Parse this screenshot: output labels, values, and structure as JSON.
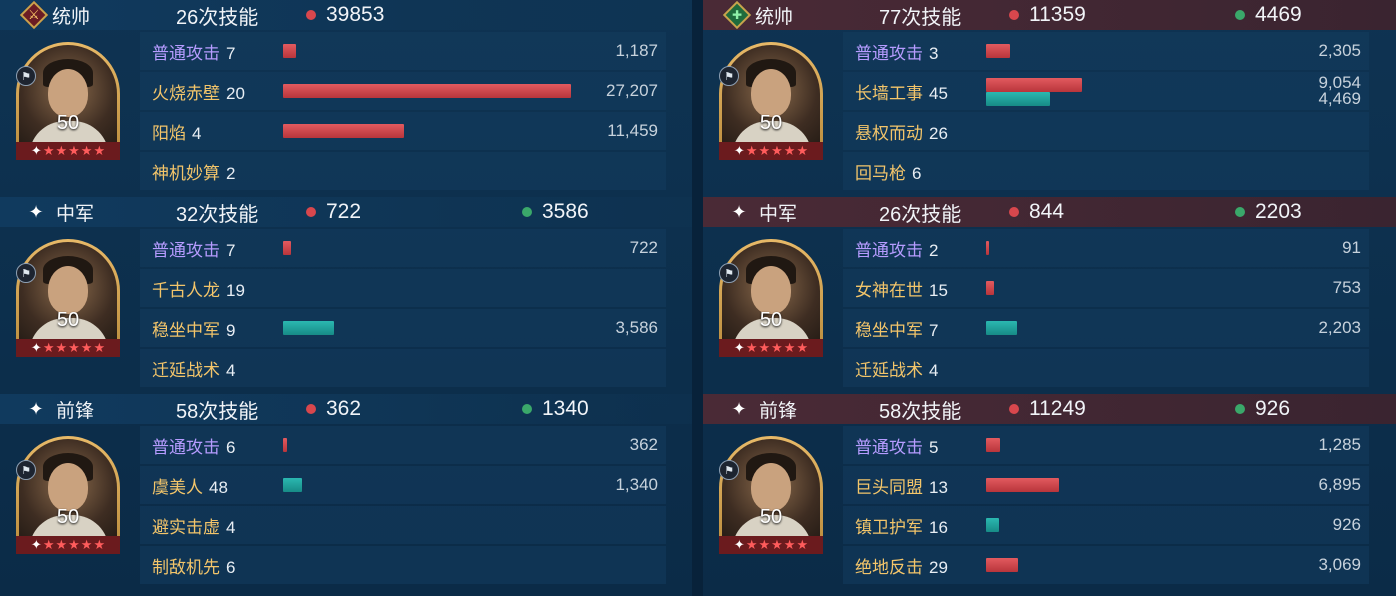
{
  "left": {
    "sections": [
      {
        "role": "统帅",
        "role_icon": "sword-icon",
        "skills": "26次技能",
        "damage": "39853",
        "heal": "",
        "level": "50",
        "stars": 5,
        "rows": [
          {
            "name": "普通攻击",
            "count": "7",
            "normal": true,
            "dmg": 1187,
            "heal": 0,
            "dmg_label": "1,187",
            "heal_label": ""
          },
          {
            "name": "火烧赤壁",
            "count": "20",
            "normal": false,
            "dmg": 27207,
            "heal": 0,
            "dmg_label": "27,207",
            "heal_label": ""
          },
          {
            "name": "阳焰",
            "count": "4",
            "normal": false,
            "dmg": 11459,
            "heal": 0,
            "dmg_label": "11,459",
            "heal_label": ""
          },
          {
            "name": "神机妙算",
            "count": "2",
            "normal": false,
            "dmg": 0,
            "heal": 0,
            "dmg_label": "",
            "heal_label": ""
          }
        ]
      },
      {
        "role": "中军",
        "role_icon": "sparkle-icon",
        "skills": "32次技能",
        "damage": "722",
        "heal": "3586",
        "level": "50",
        "stars": 5,
        "rows": [
          {
            "name": "普通攻击",
            "count": "7",
            "normal": true,
            "dmg": 722,
            "heal": 0,
            "dmg_label": "722",
            "heal_label": ""
          },
          {
            "name": "千古人龙",
            "count": "19",
            "normal": false,
            "dmg": 0,
            "heal": 0,
            "dmg_label": "",
            "heal_label": ""
          },
          {
            "name": "稳坐中军",
            "count": "9",
            "normal": false,
            "dmg": 0,
            "heal": 3586,
            "dmg_label": "",
            "heal_label": "3,586"
          },
          {
            "name": "迁延战术",
            "count": "4",
            "normal": false,
            "dmg": 0,
            "heal": 0,
            "dmg_label": "",
            "heal_label": ""
          }
        ]
      },
      {
        "role": "前锋",
        "role_icon": "sparkle-icon",
        "skills": "58次技能",
        "damage": "362",
        "heal": "1340",
        "level": "50",
        "stars": 5,
        "rows": [
          {
            "name": "普通攻击",
            "count": "6",
            "normal": true,
            "dmg": 362,
            "heal": 0,
            "dmg_label": "362",
            "heal_label": ""
          },
          {
            "name": "虞美人",
            "count": "48",
            "normal": false,
            "dmg": 0,
            "heal": 1340,
            "dmg_label": "",
            "heal_label": "1,340"
          },
          {
            "name": "避实击虚",
            "count": "4",
            "normal": false,
            "dmg": 0,
            "heal": 0,
            "dmg_label": "",
            "heal_label": ""
          },
          {
            "name": "制敌机先",
            "count": "6",
            "normal": false,
            "dmg": 0,
            "heal": 0,
            "dmg_label": "",
            "heal_label": ""
          }
        ]
      }
    ],
    "max_value": 27207
  },
  "right": {
    "sections": [
      {
        "role": "统帅",
        "role_icon": "heart-icon",
        "skills": "77次技能",
        "damage": "11359",
        "heal": "4469",
        "level": "50",
        "stars": 5,
        "rows": [
          {
            "name": "普通攻击",
            "count": "3",
            "normal": true,
            "dmg": 2305,
            "heal": 0,
            "dmg_label": "2,305",
            "heal_label": ""
          },
          {
            "name": "长墙工事",
            "count": "45",
            "normal": false,
            "dmg": 9054,
            "heal": 4469,
            "dmg_label": "9,054",
            "heal_label": "4,469"
          },
          {
            "name": "悬权而动",
            "count": "26",
            "normal": false,
            "dmg": 0,
            "heal": 0,
            "dmg_label": "",
            "heal_label": ""
          },
          {
            "name": "回马枪",
            "count": "6",
            "normal": false,
            "dmg": 0,
            "heal": 0,
            "dmg_label": "",
            "heal_label": ""
          }
        ]
      },
      {
        "role": "中军",
        "role_icon": "sparkle-icon",
        "skills": "26次技能",
        "damage": "844",
        "heal": "2203",
        "level": "50",
        "stars": 5,
        "rows": [
          {
            "name": "普通攻击",
            "count": "2",
            "normal": true,
            "dmg": 91,
            "heal": 0,
            "dmg_label": "91",
            "heal_label": ""
          },
          {
            "name": "女神在世",
            "count": "15",
            "normal": false,
            "dmg": 753,
            "heal": 0,
            "dmg_label": "753",
            "heal_label": ""
          },
          {
            "name": "稳坐中军",
            "count": "7",
            "normal": false,
            "dmg": 0,
            "heal": 2203,
            "dmg_label": "",
            "heal_label": "2,203"
          },
          {
            "name": "迁延战术",
            "count": "4",
            "normal": false,
            "dmg": 0,
            "heal": 0,
            "dmg_label": "",
            "heal_label": ""
          }
        ]
      },
      {
        "role": "前锋",
        "role_icon": "sparkle-icon",
        "skills": "58次技能",
        "damage": "11249",
        "heal": "926",
        "level": "50",
        "stars": 5,
        "rows": [
          {
            "name": "普通攻击",
            "count": "5",
            "normal": true,
            "dmg": 1285,
            "heal": 0,
            "dmg_label": "1,285",
            "heal_label": ""
          },
          {
            "name": "巨头同盟",
            "count": "13",
            "normal": false,
            "dmg": 6895,
            "heal": 0,
            "dmg_label": "6,895",
            "heal_label": ""
          },
          {
            "name": "镇卫护军",
            "count": "16",
            "normal": false,
            "dmg": 0,
            "heal": 926,
            "dmg_label": "",
            "heal_label": "926"
          },
          {
            "name": "绝地反击",
            "count": "29",
            "normal": false,
            "dmg": 3069,
            "heal": 0,
            "dmg_label": "3,069",
            "heal_label": ""
          }
        ]
      }
    ],
    "max_value": 27207
  },
  "colors": {
    "damage": "#d8474d",
    "heal": "#2bb8b0",
    "skill_name": "#f3c56a",
    "normal_attack": "#b69cff"
  }
}
